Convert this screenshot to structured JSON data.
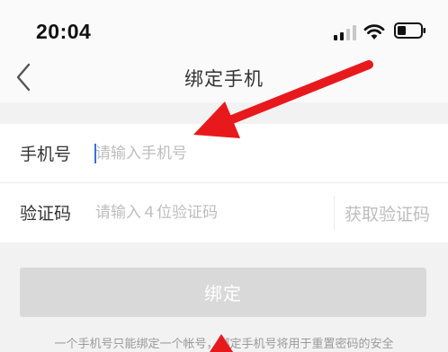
{
  "status_bar": {
    "time": "20:04",
    "icons": [
      "signal-icon",
      "wifi-icon",
      "battery-icon"
    ]
  },
  "nav": {
    "title": "绑定手机",
    "back_icon": "back-chevron-icon"
  },
  "form": {
    "phone_label": "手机号",
    "phone_placeholder": "请输入手机号",
    "phone_value": "",
    "code_label": "验证码",
    "code_placeholder": "请输入４位验证码",
    "code_value": "",
    "get_code_label": "获取验证码"
  },
  "bind_button_label": "绑定",
  "note": "一个手机号只能绑定一个帐号，绑定手机号将用于重置密码的安全",
  "colors": {
    "annotation_arrow": "#e8191c",
    "cursor": "#3b6fd8",
    "disabled_button": "#d9d9d9",
    "placeholder": "#bdbdbd"
  }
}
